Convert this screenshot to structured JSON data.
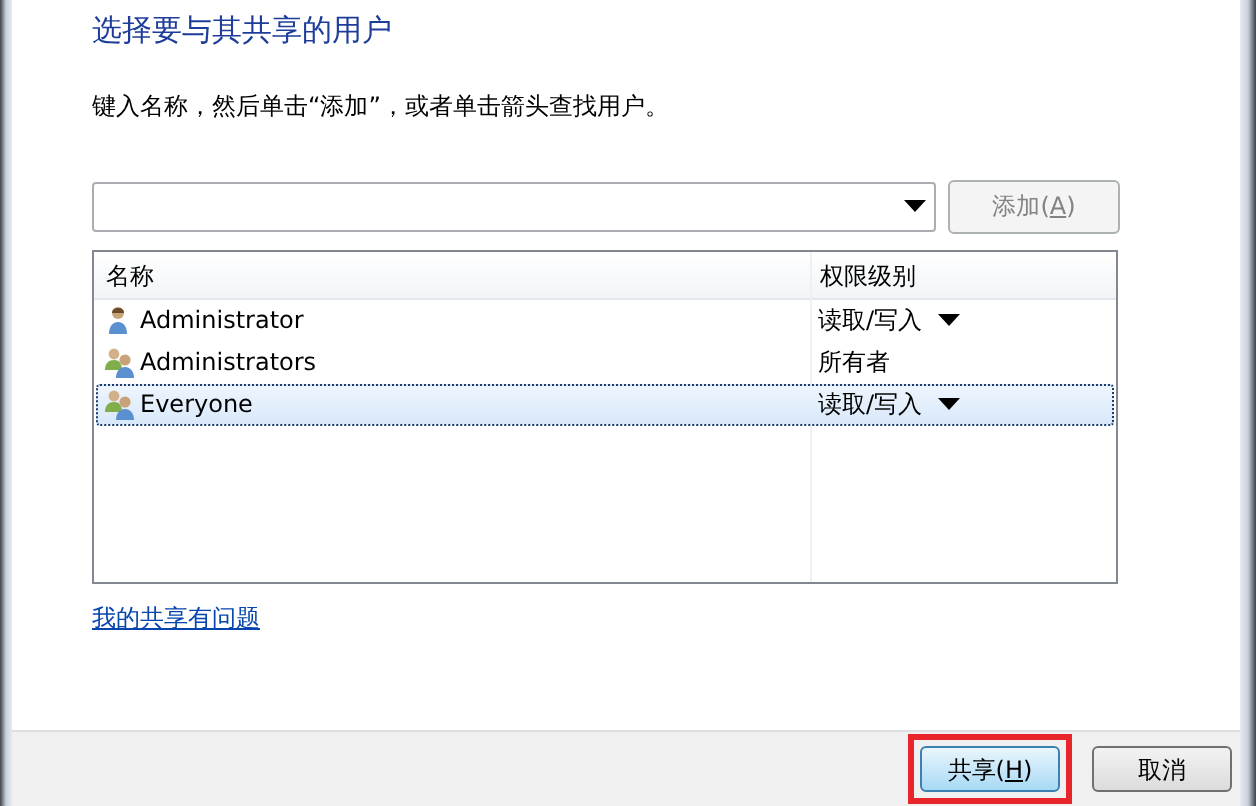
{
  "heading": "选择要与其共享的用户",
  "instruction": "键入名称，然后单击“添加”，或者单击箭头查找用户。",
  "add_button": {
    "label": "添加(A)",
    "disabled": true
  },
  "table": {
    "columns": [
      "名称",
      "权限级别"
    ],
    "rows": [
      {
        "kind": "user",
        "name": "Administrator",
        "permission": "读取/写入",
        "has_dropdown": true,
        "selected": false
      },
      {
        "kind": "group",
        "name": "Administrators",
        "permission": "所有者",
        "has_dropdown": false,
        "selected": false
      },
      {
        "kind": "group",
        "name": "Everyone",
        "permission": "读取/写入",
        "has_dropdown": true,
        "selected": true
      }
    ]
  },
  "help_link": "我的共享有问题",
  "footer_buttons": [
    {
      "label": "共享(H)",
      "default": true,
      "highlighted": true
    },
    {
      "label": "取消",
      "default": false,
      "highlighted": false
    }
  ]
}
